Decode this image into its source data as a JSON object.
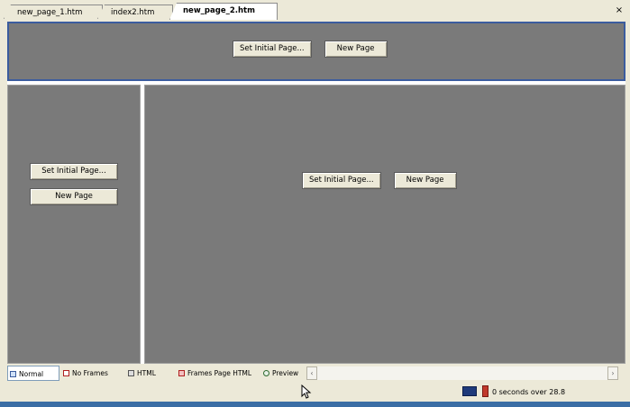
{
  "tabs": [
    {
      "label": "new_page_1.htm",
      "active": false
    },
    {
      "label": "index2.htm",
      "active": false
    },
    {
      "label": "new_page_2.htm",
      "active": true
    }
  ],
  "close_label": "×",
  "frames": {
    "top": {
      "set_initial": "Set Initial Page...",
      "new_page": "New Page"
    },
    "left": {
      "set_initial": "Set Initial Page...",
      "new_page": "New Page"
    },
    "main": {
      "set_initial": "Set Initial Page...",
      "new_page": "New Page"
    }
  },
  "view_tabs": [
    {
      "label": "Normal",
      "icon": "normal-view-icon",
      "active": true
    },
    {
      "label": "No Frames",
      "icon": "no-frames-icon",
      "active": false
    },
    {
      "label": "HTML",
      "icon": "html-icon",
      "active": false
    },
    {
      "label": "Frames Page HTML",
      "icon": "frames-page-html-icon",
      "active": false
    },
    {
      "label": "Preview",
      "icon": "preview-icon",
      "active": false
    }
  ],
  "scroll": {
    "left": "‹",
    "right": "›"
  },
  "status": {
    "download_time": "0 seconds over 28.8"
  },
  "colors": {
    "frame_bg": "#7a7a7a",
    "selected_frame_border": "#3b5c9e",
    "chrome": "#ece9d8"
  }
}
